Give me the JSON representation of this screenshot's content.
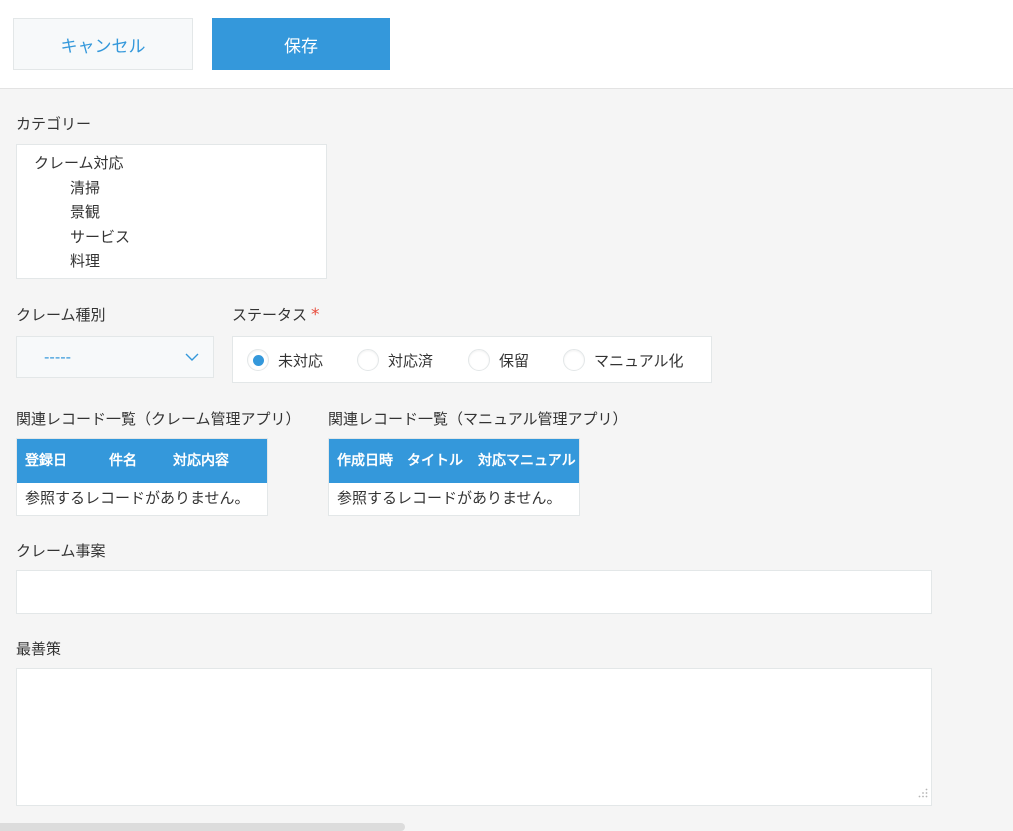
{
  "toolbar": {
    "cancel_label": "キャンセル",
    "save_label": "保存"
  },
  "category": {
    "label": "カテゴリー",
    "tree": {
      "root": "クレーム対応",
      "children": [
        "清掃",
        "景観",
        "サービス",
        "料理"
      ]
    }
  },
  "claim_type": {
    "label": "クレーム種別",
    "selected": "-----"
  },
  "status": {
    "label": "ステータス",
    "required_mark": "*",
    "options": [
      {
        "label": "未対応",
        "selected": true
      },
      {
        "label": "対応済",
        "selected": false
      },
      {
        "label": "保留",
        "selected": false
      },
      {
        "label": "マニュアル化",
        "selected": false
      }
    ]
  },
  "related_claims": {
    "label": "関連レコード一覧（クレーム管理アプリ）",
    "columns": [
      "登録日",
      "件名",
      "対応内容"
    ],
    "empty_text": "参照するレコードがありません。"
  },
  "related_manuals": {
    "label": "関連レコード一覧（マニュアル管理アプリ）",
    "columns": [
      "作成日時",
      "タイトル",
      "対応マニュアル"
    ],
    "empty_text": "参照するレコードがありません。"
  },
  "claim_case": {
    "label": "クレーム事案",
    "value": ""
  },
  "best_practice": {
    "label": "最善策",
    "value": ""
  },
  "colors": {
    "accent": "#3498db",
    "required": "#e74c3c",
    "background": "#f5f5f5"
  }
}
